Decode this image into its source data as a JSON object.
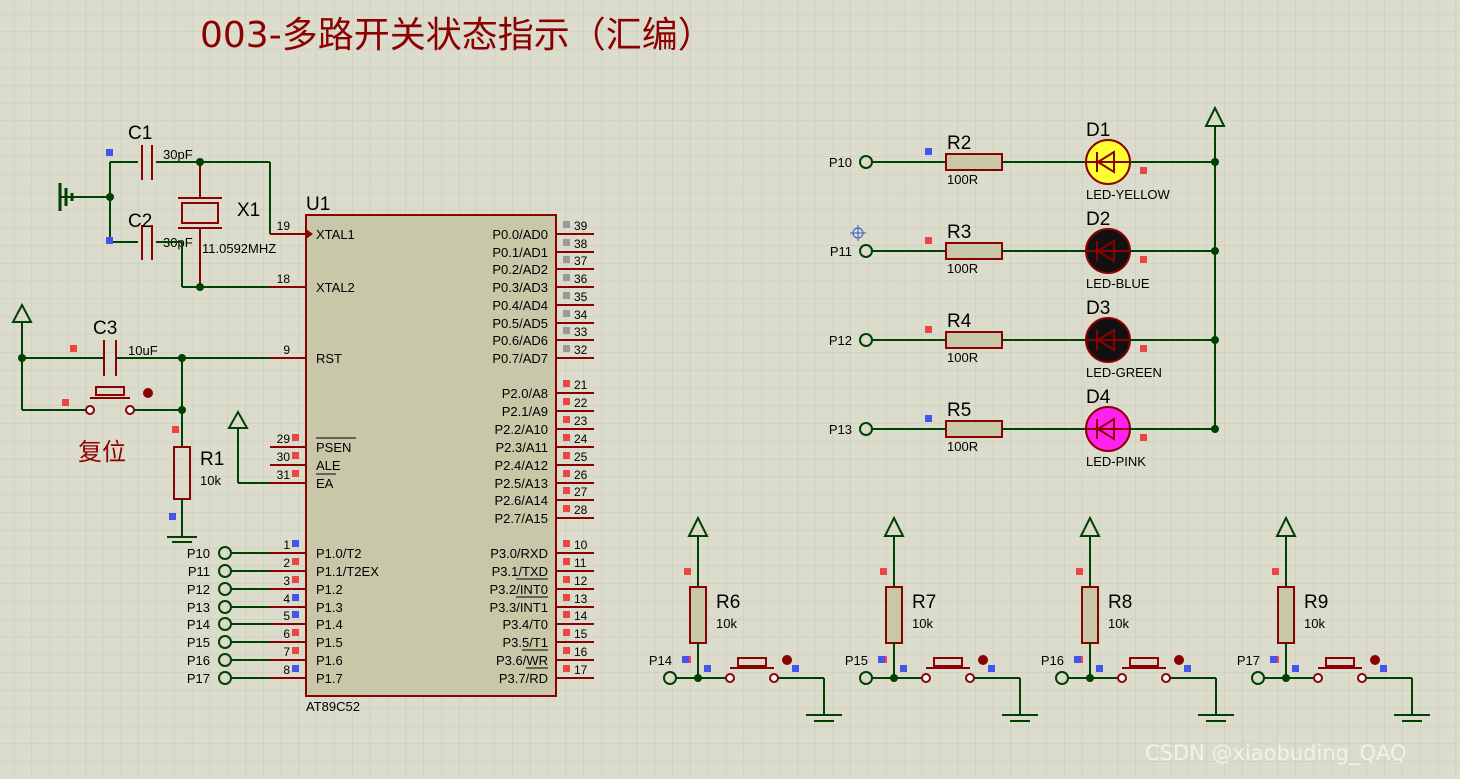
{
  "title": "003-多路开关状态指示（汇编）",
  "watermark": "CSDN @xiaobuding_QAQ",
  "reset_label": "复位",
  "colors": {
    "background": "#dcdccc",
    "grid": "#c7c7b7",
    "wire": "#004000",
    "component": "#8b0000",
    "chip_fill": "#c8c8a8",
    "led_yellow": "#ffff33",
    "led_pink": "#ff22ee",
    "led_off": "#111111"
  },
  "mcu": {
    "ref": "U1",
    "part": "AT89C52",
    "left_pins": [
      {
        "num": "19",
        "name": "XTAL1"
      },
      {
        "num": "18",
        "name": "XTAL2"
      },
      {
        "num": "9",
        "name": "RST"
      },
      {
        "num": "29",
        "name": "PSEN"
      },
      {
        "num": "30",
        "name": "ALE"
      },
      {
        "num": "31",
        "name": "EA"
      },
      {
        "num": "1",
        "name": "P1.0/T2"
      },
      {
        "num": "2",
        "name": "P1.1/T2EX"
      },
      {
        "num": "3",
        "name": "P1.2"
      },
      {
        "num": "4",
        "name": "P1.3"
      },
      {
        "num": "5",
        "name": "P1.4"
      },
      {
        "num": "6",
        "name": "P1.5"
      },
      {
        "num": "7",
        "name": "P1.6"
      },
      {
        "num": "8",
        "name": "P1.7"
      }
    ],
    "right_pins": [
      {
        "num": "39",
        "name": "P0.0/AD0"
      },
      {
        "num": "38",
        "name": "P0.1/AD1"
      },
      {
        "num": "37",
        "name": "P0.2/AD2"
      },
      {
        "num": "36",
        "name": "P0.3/AD3"
      },
      {
        "num": "35",
        "name": "P0.4/AD4"
      },
      {
        "num": "34",
        "name": "P0.5/AD5"
      },
      {
        "num": "33",
        "name": "P0.6/AD6"
      },
      {
        "num": "32",
        "name": "P0.7/AD7"
      },
      {
        "num": "21",
        "name": "P2.0/A8"
      },
      {
        "num": "22",
        "name": "P2.1/A9"
      },
      {
        "num": "23",
        "name": "P2.2/A10"
      },
      {
        "num": "24",
        "name": "P2.3/A11"
      },
      {
        "num": "25",
        "name": "P2.4/A12"
      },
      {
        "num": "26",
        "name": "P2.5/A13"
      },
      {
        "num": "27",
        "name": "P2.6/A14"
      },
      {
        "num": "28",
        "name": "P2.7/A15"
      },
      {
        "num": "10",
        "name": "P3.0/RXD"
      },
      {
        "num": "11",
        "name": "P3.1/TXD"
      },
      {
        "num": "12",
        "name": "P3.2/INT0"
      },
      {
        "num": "13",
        "name": "P3.3/INT1"
      },
      {
        "num": "14",
        "name": "P3.4/T0"
      },
      {
        "num": "15",
        "name": "P3.5/T1"
      },
      {
        "num": "16",
        "name": "P3.6/WR"
      },
      {
        "num": "17",
        "name": "P3.7/RD"
      }
    ]
  },
  "port_terminals": [
    "P10",
    "P11",
    "P12",
    "P13",
    "P14",
    "P15",
    "P16",
    "P17"
  ],
  "oscillator": {
    "c1": {
      "ref": "C1",
      "value": "30pF"
    },
    "c2": {
      "ref": "C2",
      "value": "30pF"
    },
    "x1": {
      "ref": "X1",
      "value": "11.0592MHZ"
    }
  },
  "reset_circuit": {
    "c3": {
      "ref": "C3",
      "value": "10uF"
    },
    "r1": {
      "ref": "R1",
      "value": "10k"
    }
  },
  "leds": [
    {
      "ref": "D1",
      "part": "LED-YELLOW",
      "resistor": "R2",
      "rvalue": "100R",
      "terminal": "P10",
      "state": "on",
      "color": "#ffff33"
    },
    {
      "ref": "D2",
      "part": "LED-BLUE",
      "resistor": "R3",
      "rvalue": "100R",
      "terminal": "P11",
      "state": "off",
      "color": "#111111"
    },
    {
      "ref": "D3",
      "part": "LED-GREEN",
      "resistor": "R4",
      "rvalue": "100R",
      "terminal": "P12",
      "state": "off",
      "color": "#111111"
    },
    {
      "ref": "D4",
      "part": "LED-PINK",
      "resistor": "R5",
      "rvalue": "100R",
      "terminal": "P13",
      "state": "on",
      "color": "#ff22ee"
    }
  ],
  "switches": [
    {
      "resistor": "R6",
      "rvalue": "10k",
      "terminal": "P14"
    },
    {
      "resistor": "R7",
      "rvalue": "10k",
      "terminal": "P15"
    },
    {
      "resistor": "R8",
      "rvalue": "10k",
      "terminal": "P16"
    },
    {
      "resistor": "R9",
      "rvalue": "10k",
      "terminal": "P17"
    }
  ]
}
